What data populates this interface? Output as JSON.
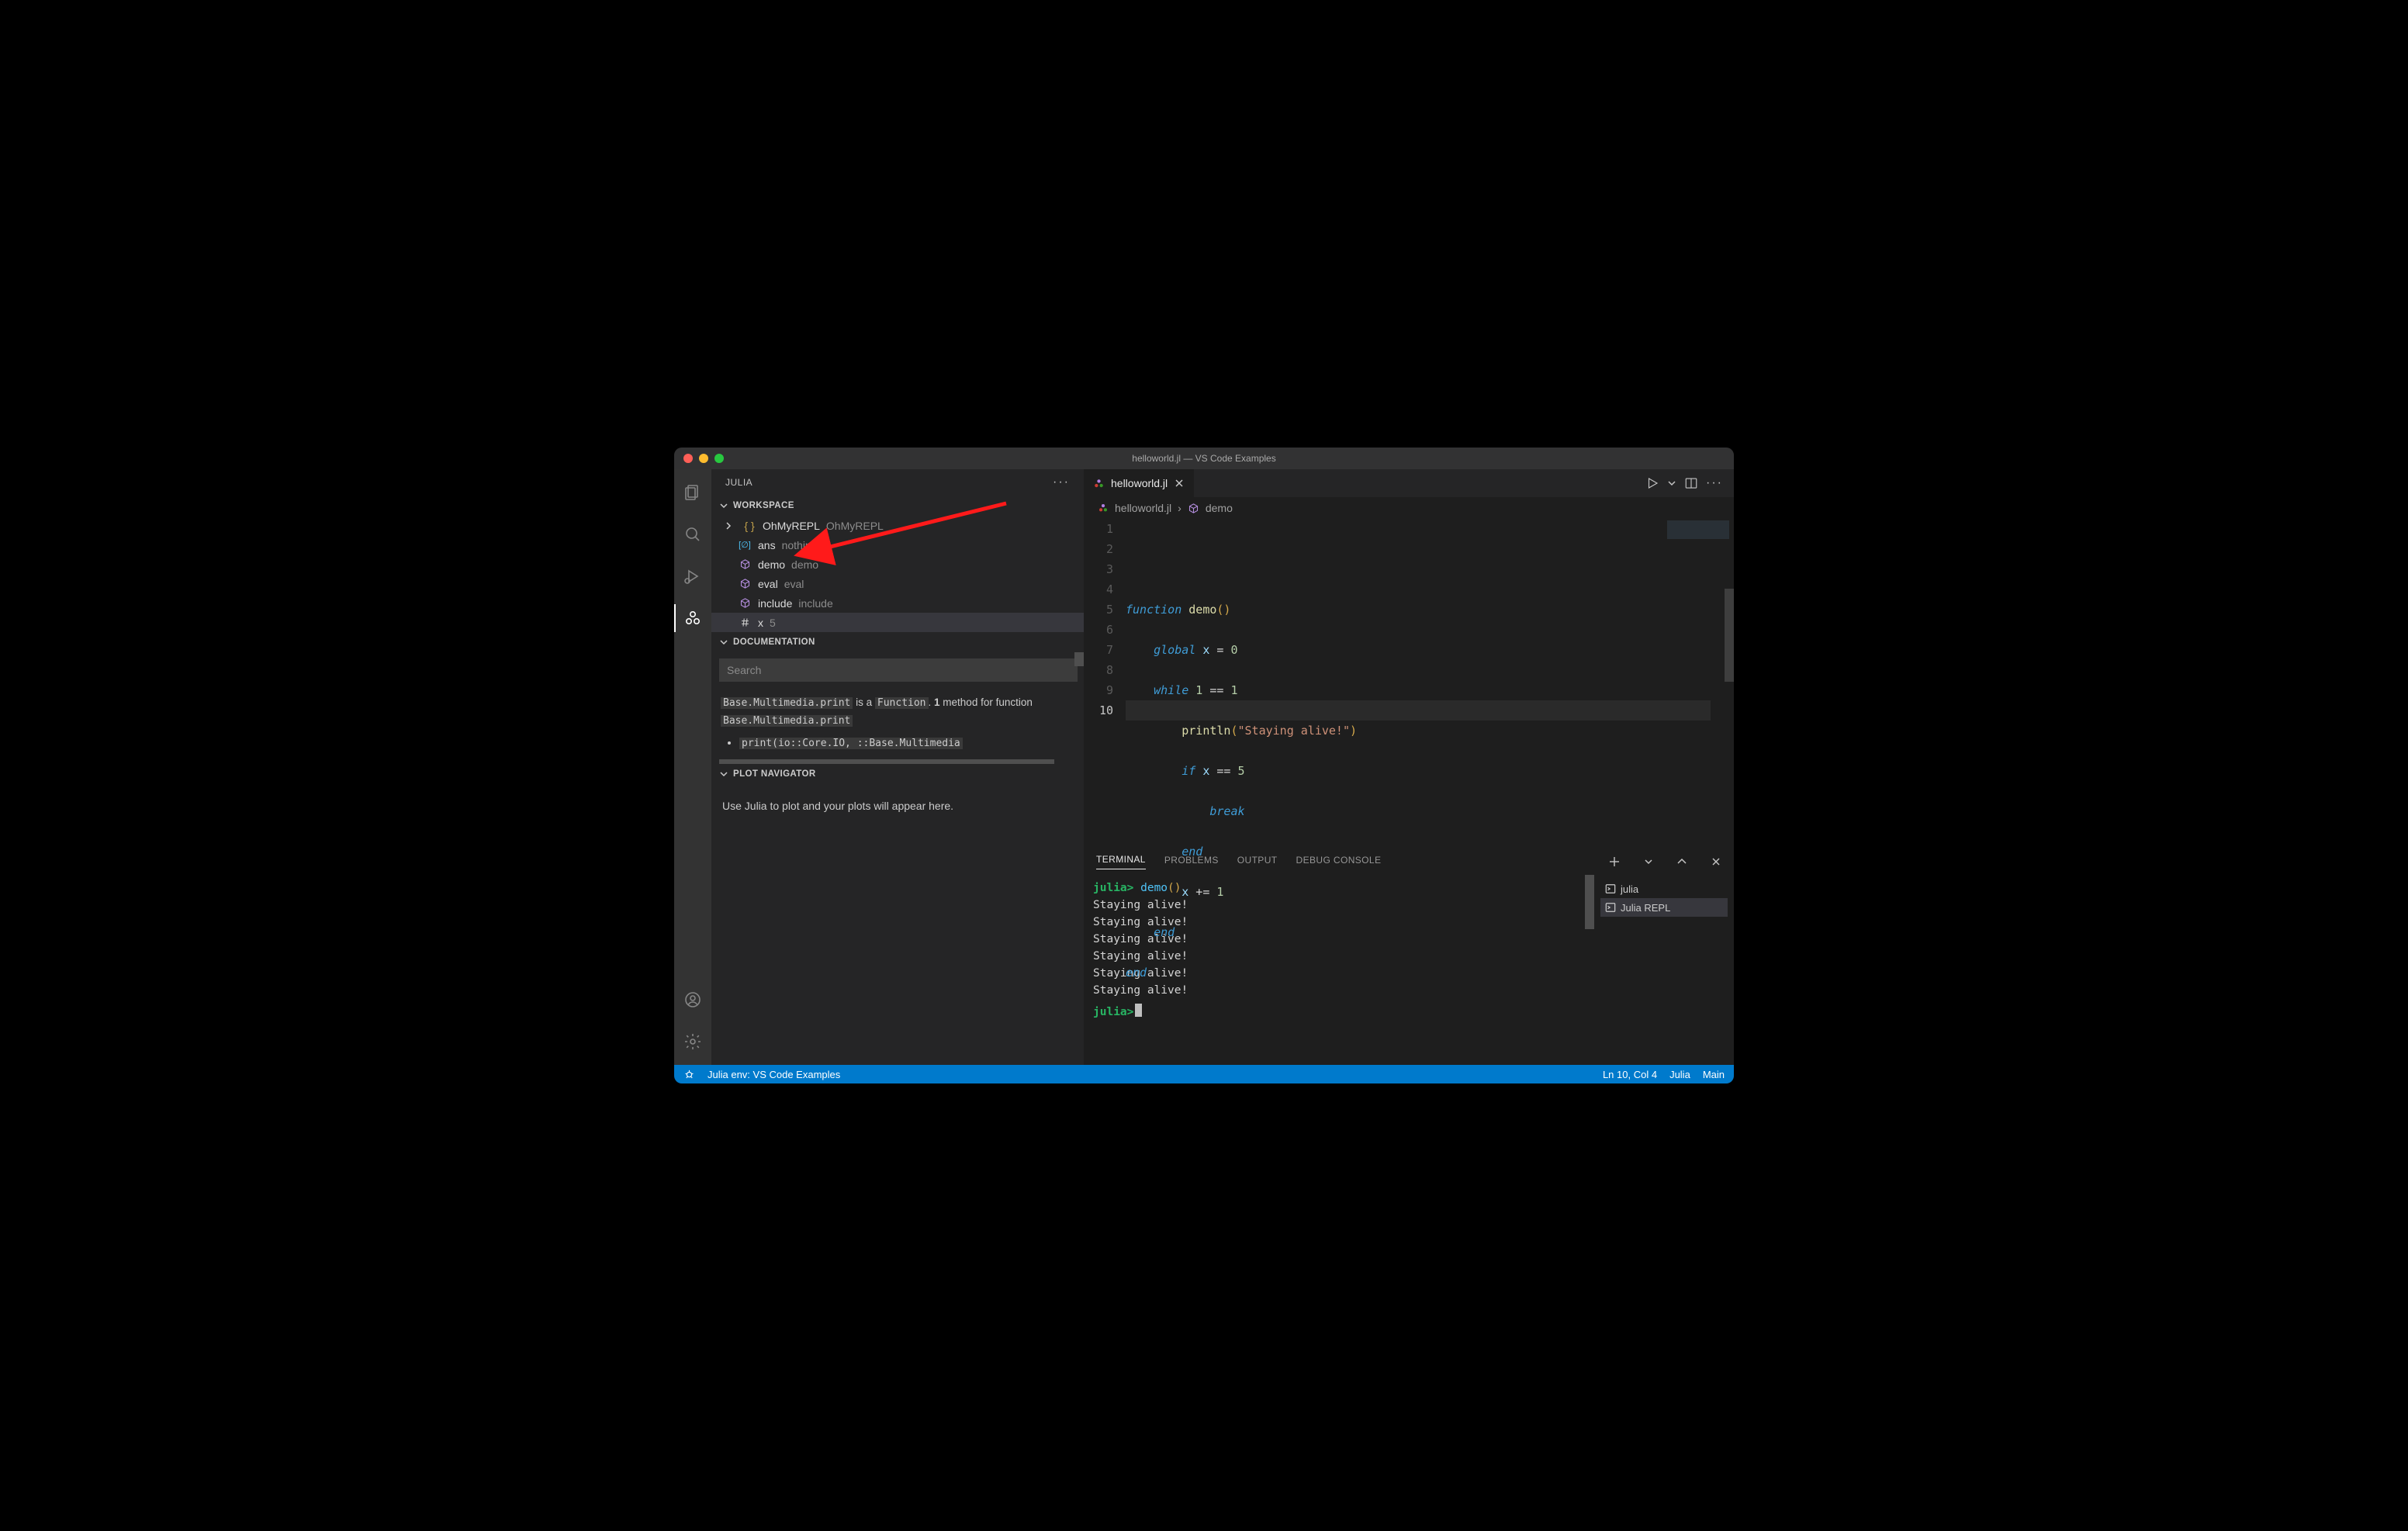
{
  "window": {
    "title": "helloworld.jl — VS Code Examples"
  },
  "sidebar": {
    "title": "JULIA",
    "sections": {
      "workspace": {
        "header": "WORKSPACE",
        "rows": [
          {
            "icon": "braces-icon",
            "name": "OhMyREPL",
            "value": "OhMyREPL",
            "caret": true
          },
          {
            "icon": "const-icon",
            "name": "ans",
            "value": "nothing"
          },
          {
            "icon": "cube-icon",
            "name": "demo",
            "value": "demo"
          },
          {
            "icon": "cube-icon",
            "name": "eval",
            "value": "eval"
          },
          {
            "icon": "cube-icon",
            "name": "include",
            "value": "include"
          },
          {
            "icon": "hash-icon",
            "name": "x",
            "value": "5",
            "selected": true
          }
        ]
      },
      "documentation": {
        "header": "DOCUMENTATION",
        "search_placeholder": "Search",
        "text_prefix1": "Base.Multimedia.print",
        "text_isa": " is a ",
        "text_func": "Function",
        "text_dot": ". ",
        "text_bold1": "1",
        "text_meth": " method for function ",
        "text_prefix2": "Base.Multimedia.print",
        "bullet": "print(io::Core.IO, ::Base.Multimedia"
      },
      "plot": {
        "header": "PLOT NAVIGATOR",
        "body": "Use Julia to plot and your plots will appear here."
      }
    }
  },
  "editor": {
    "tab": {
      "label": "helloworld.jl"
    },
    "breadcrumb": {
      "file": "helloworld.jl",
      "symbol": "demo"
    },
    "lines": [
      "1",
      "2",
      "3",
      "4",
      "5",
      "6",
      "7",
      "8",
      "9",
      "10"
    ],
    "code": {
      "l1": {
        "kw": "function",
        "fn": " demo",
        "par": "()"
      },
      "l2": {
        "kw": "global",
        "var": " x",
        "op": " = ",
        "num": "0"
      },
      "l3": {
        "kw": "while",
        "num1": " 1",
        "op": " == ",
        "num2": "1"
      },
      "l4": {
        "fn": "println",
        "par": "(",
        "str": "\"Staying alive!\"",
        "par2": ")"
      },
      "l5": {
        "kw": "if",
        "var": " x",
        "op": " == ",
        "num": "5"
      },
      "l6": {
        "kw": "break"
      },
      "l7": {
        "kw": "end"
      },
      "l8": {
        "var": "x",
        "op": " += ",
        "num": "1"
      },
      "l9": {
        "kw": "end"
      },
      "l10": {
        "kw": "end"
      }
    }
  },
  "panel": {
    "tabs": {
      "terminal": "TERMINAL",
      "problems": "PROBLEMS",
      "output": "OUTPUT",
      "debug": "DEBUG CONSOLE"
    },
    "terminal": {
      "prompt": "julia>",
      "call": " demo",
      "par": "()",
      "lines": [
        "Staying alive!",
        "Staying alive!",
        "Staying alive!",
        "Staying alive!",
        "Staying alive!",
        "Staying alive!"
      ]
    },
    "aside": {
      "julia": "julia",
      "repl": "Julia REPL"
    }
  },
  "status": {
    "env": "Julia env: VS Code Examples",
    "pos": "Ln 10, Col 4",
    "lang": "Julia",
    "branch": "Main"
  }
}
